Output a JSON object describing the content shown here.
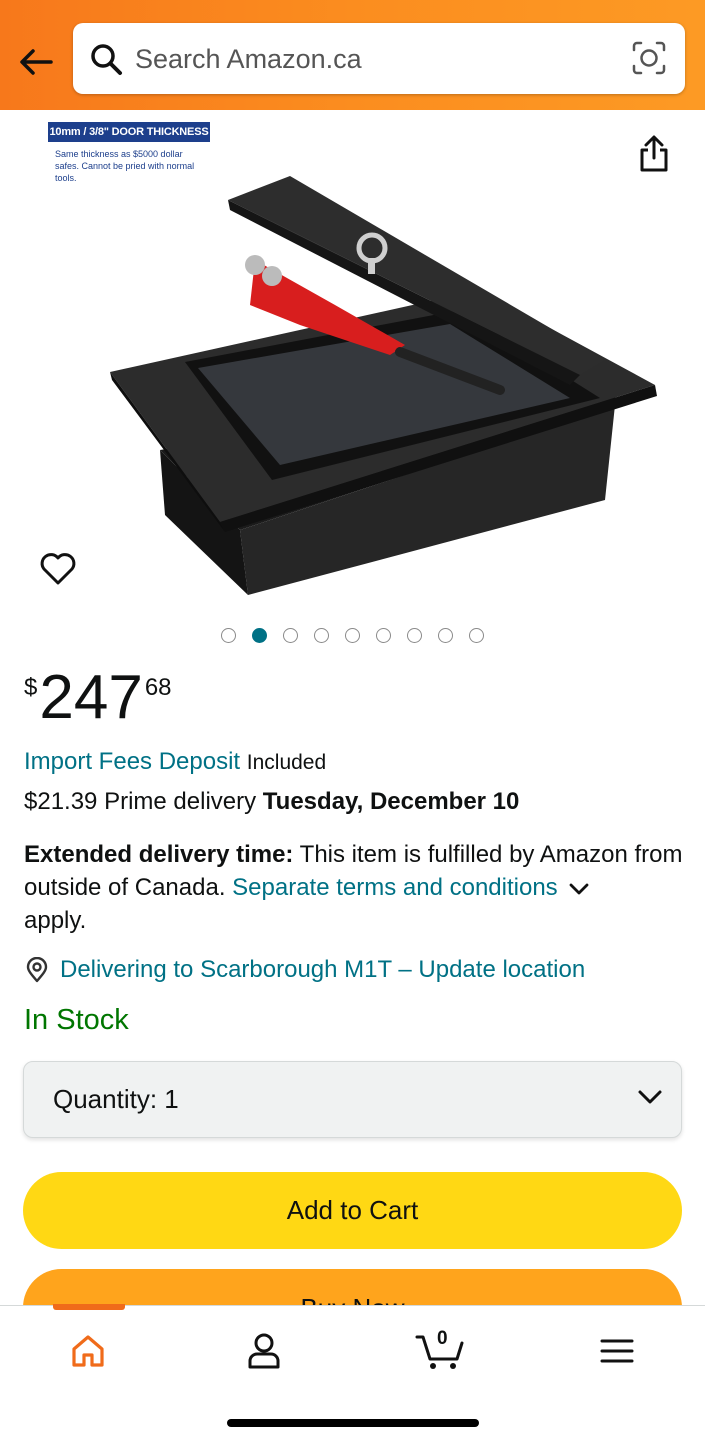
{
  "header": {
    "search_placeholder": "Search Amazon.ca"
  },
  "product_image": {
    "thickness_label": "10mm / 3/8\" DOOR THICKNESS",
    "thickness_description": "Same thickness as $5000 dollar safes. Cannot be pried with normal tools.",
    "carousel": {
      "count": 9,
      "active_index": 1
    }
  },
  "price": {
    "currency": "$",
    "whole": "247",
    "fraction": "68"
  },
  "import_fees": {
    "link": "Import Fees Deposit",
    "status": "Included"
  },
  "delivery": {
    "prefix": "$21.39 Prime delivery",
    "date": "Tuesday, December 10"
  },
  "extended": {
    "label": "Extended delivery time:",
    "text": "This item is fulfilled by Amazon from outside of Canada.",
    "link": "Separate terms and conditions",
    "suffix": "apply."
  },
  "location": {
    "text": "Delivering to Scarborough M1T – Update location"
  },
  "stock": {
    "status": "In Stock"
  },
  "quantity": {
    "label": "Quantity:",
    "value": "1"
  },
  "buttons": {
    "add_to_cart": "Add to Cart",
    "buy_now": "Buy Now"
  },
  "bottom_nav": {
    "cart_count": "0"
  },
  "colors": {
    "header_orange": "#f7781b",
    "link_teal": "#007185",
    "in_stock_green": "#007600",
    "add_to_cart_yellow": "#ffd814",
    "buy_now_orange": "#ffa41c"
  }
}
